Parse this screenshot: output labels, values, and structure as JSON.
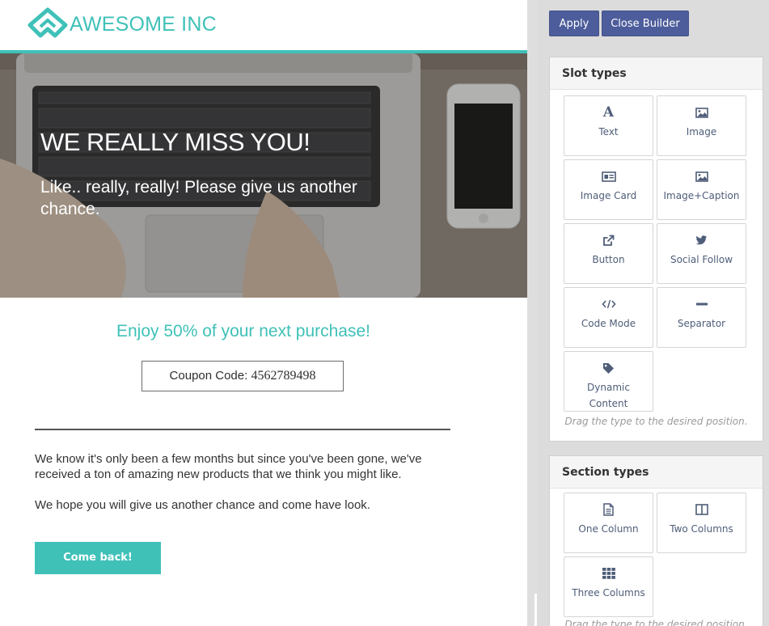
{
  "email": {
    "brand": "AWESOME INC",
    "hero_title": "WE REALLY MISS YOU!",
    "hero_subtitle": "Like.. really, really! Please give us another chance.",
    "offer": "Enjoy 50% of your next purchase!",
    "coupon_label": "Coupon Code: ",
    "coupon_code": "4562789498",
    "paragraph_1": "We know it's only been a few months but since you've been gone, we've received a ton of amazing new products that we think you might like.",
    "paragraph_2": "We hope you will give us another chance and come have look.",
    "cta_label": "Come back!",
    "accent_color": "#3fc1b8"
  },
  "builder": {
    "apply_label": "Apply",
    "close_label": "Close Builder",
    "button_color": "#4d5d9b",
    "slot_panel": {
      "title": "Slot types",
      "hint": "Drag the type to the desired position.",
      "items": [
        {
          "label": "Text",
          "icon": "text-font-icon"
        },
        {
          "label": "Image",
          "icon": "image-icon"
        },
        {
          "label": "Image Card",
          "icon": "id-card-icon"
        },
        {
          "label": "Image+Caption",
          "icon": "image-icon"
        },
        {
          "label": "Button",
          "icon": "external-link-icon"
        },
        {
          "label": "Social Follow",
          "icon": "twitter-icon"
        },
        {
          "label": "Code Mode",
          "icon": "code-icon"
        },
        {
          "label": "Separator",
          "icon": "minus-icon"
        },
        {
          "label": "Dynamic Content",
          "icon": "tag-icon"
        }
      ]
    },
    "section_panel": {
      "title": "Section types",
      "hint": "Drag the type to the desired position.",
      "items": [
        {
          "label": "One Column",
          "icon": "file-icon"
        },
        {
          "label": "Two Columns",
          "icon": "columns-icon"
        },
        {
          "label": "Three Columns",
          "icon": "grid-icon"
        }
      ]
    }
  }
}
